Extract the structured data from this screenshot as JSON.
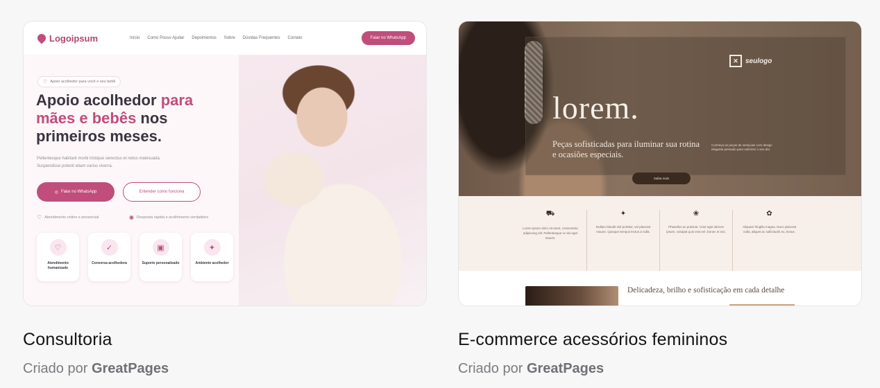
{
  "cards": [
    {
      "title": "Consultoria",
      "author_prefix": "Criado por",
      "author": "GreatPages",
      "preview": {
        "logo": "Logoipsum",
        "menu": [
          "Início",
          "Como Posso Ajudar",
          "Depoimentos",
          "Sobre",
          "Dúvidas Frequentes",
          "Contato"
        ],
        "nav_cta": "Falar no WhatsApp",
        "badge": "Apoio acolhedor para você e seu bebê",
        "headline_1": "Apoio acolhedor ",
        "headline_pink_1": "para",
        "headline_pink_2": "mães e bebês",
        "headline_2": " nos",
        "headline_3": "primeiros meses.",
        "lead": "Pellentesque habitant morbi tristique senectus et netus malesuada. Suspendisse potenti etiam varius viverra.",
        "btn_primary": "Falar no WhatsApp",
        "btn_outline": "Entender como funciona",
        "feature_1": "Atendimento online e presencial",
        "feature_2": "Resposta rápida e acolhimento verdadeiro",
        "tiles": [
          {
            "label": "Atendimento humanizado",
            "icon": "heart-icon"
          },
          {
            "label": "Conversa acolhedora",
            "icon": "check-circle-icon"
          },
          {
            "label": "Suporte personalizado",
            "icon": "profile-card-icon"
          },
          {
            "label": "Ambiente acolhedor",
            "icon": "sparkle-icon"
          }
        ],
        "accent": "#c04d7b"
      }
    },
    {
      "title": "E-commerce acessórios femininos",
      "author_prefix": "Criado por",
      "author": "GreatPages",
      "preview": {
        "brand": "seulogo",
        "hero_title": "lorem.",
        "tagline": "Peças sofisticadas para iluminar sua rotina e ocasiões especiais.",
        "side_text": "Conheça as peças de semijoias com design elegante pensado para valorizar o seu dia.",
        "hero_button": "Saiba mais",
        "benefits": [
          {
            "icon": "cart-icon",
            "text": "Lorem ipsum dolor sit amet, consectetur adipiscing elit. Pellentesque in nisi eget mauris."
          },
          {
            "icon": "sparkle-icon",
            "text": "Nullam blandit nisl porttitor, vel placerat mauris. Quisque tempus lectus a nulla."
          },
          {
            "icon": "gift-icon",
            "text": "Phasellus ac pulvinar. Cras eget ultrices ipsum, volutpat quis erat vel. Donec et nisi."
          },
          {
            "icon": "gear-icon",
            "text": "Aliquam fringilla magna. Nunc placerat nulla, aliquet ac sollicitudin eu, lectus."
          }
        ],
        "bottom_title": "Delicadeza, brilho e sofisticação em cada detalhe",
        "accent": "#3b2a1f"
      }
    }
  ]
}
